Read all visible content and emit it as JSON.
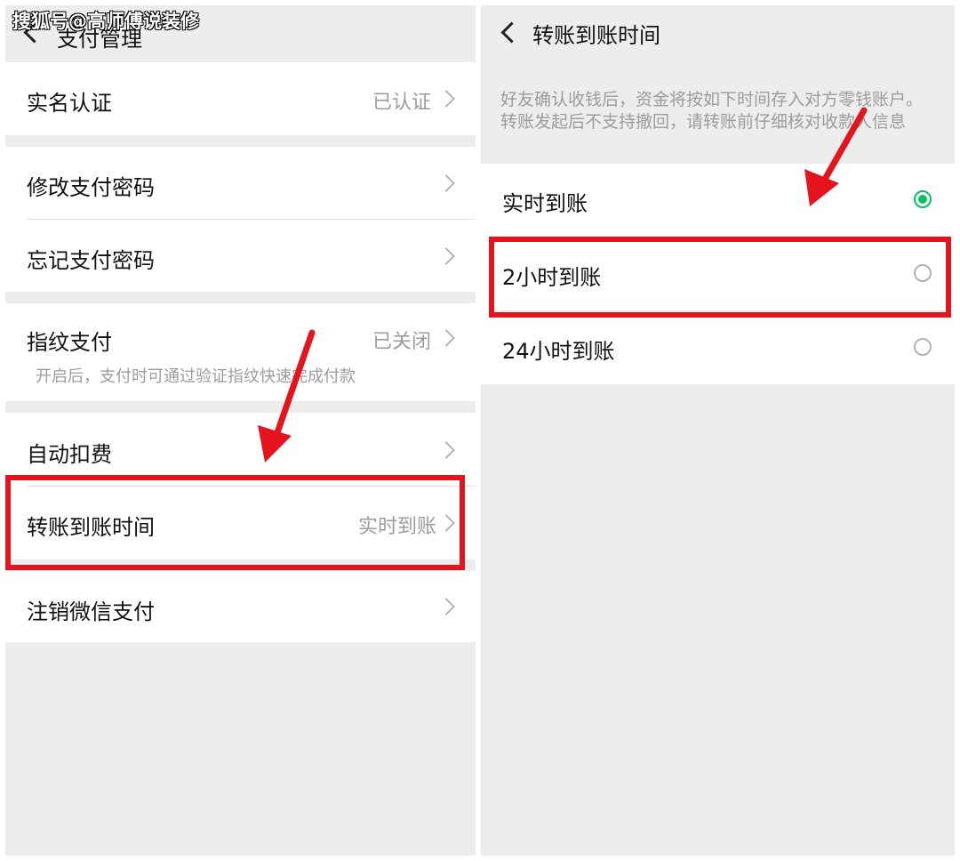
{
  "watermark": "搜狐号@高师傅说装修",
  "left": {
    "nav_title": "支付管理",
    "rows": {
      "realname": {
        "label": "实名认证",
        "value": "已认证"
      },
      "change_pwd": {
        "label": "修改支付密码"
      },
      "forgot_pwd": {
        "label": "忘记支付密码"
      },
      "fingerprint": {
        "label": "指纹支付",
        "value": "已关闭",
        "desc": "开启后，支付时可通过验证指纹快速完成付款"
      },
      "auto_deduct": {
        "label": "自动扣费"
      },
      "transfer_time": {
        "label": "转账到账时间",
        "value": "实时到账"
      },
      "cancel_pay": {
        "label": "注销微信支付"
      }
    }
  },
  "right": {
    "nav_title": "转账到账时间",
    "description": "好友确认收钱后，资金将按如下时间存入对方零钱账户。转账发起后不支持撤回，请转账前仔细核对收款人信息",
    "options": [
      {
        "label": "实时到账",
        "selected": true
      },
      {
        "label": "2小时到账",
        "selected": false
      },
      {
        "label": "24小时到账",
        "selected": false
      }
    ]
  },
  "colors": {
    "accent_green": "#07c160",
    "highlight_red": "#e4141f",
    "background_gray": "#ededed"
  },
  "icons": [
    "back-chevron-icon",
    "chevron-right-icon",
    "radio-selected-icon",
    "radio-unselected-icon",
    "red-arrow-annotation"
  ]
}
